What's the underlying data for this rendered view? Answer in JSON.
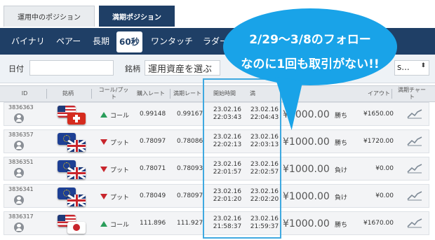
{
  "tabs": [
    {
      "label": "運用中のポジション",
      "active": false
    },
    {
      "label": "満期ポジション",
      "active": true
    }
  ],
  "nav": [
    "バイナリ",
    "ペアー",
    "長期",
    "60秒",
    "ワンタッチ",
    "ラダー"
  ],
  "nav_active": "60秒",
  "filter": {
    "date_label": "日付",
    "asset_label": "銘柄",
    "asset_value": "運用資産を選ぶ",
    "second_select_value": "s..."
  },
  "columns": {
    "id": "ID",
    "symbol": "銘柄",
    "callput_1": "コール/プッ",
    "callput_2": "ト",
    "buy_rate": "購入レート",
    "exp_rate": "満期レート",
    "start_time": "開始時間",
    "expiry": "満",
    "payout": "イアウト",
    "chart_1": "満期チャー",
    "chart_2": "ト"
  },
  "rows": [
    {
      "id": "3836363",
      "flags": [
        "us",
        "ch"
      ],
      "dir": "コール",
      "up": true,
      "buy": "0.99148",
      "exp": "0.99167",
      "start_date": "23.02.16",
      "start_time": "22:03:43",
      "end_date": "23.02.16",
      "end_time": "22:04:43",
      "amount": "¥1000.00",
      "result": "勝ち",
      "payout": "¥1650.00"
    },
    {
      "id": "3836357",
      "flags": [
        "eu",
        "gb"
      ],
      "dir": "プット",
      "up": false,
      "buy": "0.78097",
      "exp": "0.78086",
      "start_date": "23.02.16",
      "start_time": "22:02:13",
      "end_date": "23.02.16",
      "end_time": "22:03:13",
      "amount": "¥1000.00",
      "result": "勝ち",
      "payout": "¥1720.00"
    },
    {
      "id": "3836351",
      "flags": [
        "eu",
        "gb"
      ],
      "dir": "プット",
      "up": false,
      "buy": "0.78071",
      "exp": "0.78093",
      "start_date": "23.02.16",
      "start_time": "22:01:57",
      "end_date": "23.02.16",
      "end_time": "22:02:57",
      "amount": "¥1000.00",
      "result": "負け",
      "payout": "¥0.00"
    },
    {
      "id": "3836341",
      "flags": [
        "eu",
        "gb"
      ],
      "dir": "プット",
      "up": false,
      "buy": "0.78049",
      "exp": "0.78097",
      "start_date": "23.02.16",
      "start_time": "22:01:20",
      "end_date": "23.02.16",
      "end_time": "22:02:20",
      "amount": "¥1000.00",
      "result": "負け",
      "payout": "¥0.00"
    },
    {
      "id": "3836317",
      "flags": [
        "us",
        "jp"
      ],
      "dir": "コール",
      "up": true,
      "buy": "111.896",
      "exp": "111.927",
      "start_date": "23.02.16",
      "start_time": "21:58:37",
      "end_date": "23.02.16",
      "end_time": "21:59:37",
      "amount": "¥1000.00",
      "result": "勝ち",
      "payout": "¥1670.00"
    }
  ],
  "callout": {
    "line1": "2/29〜3/8のフォロー",
    "line2": "なのに1回も取引がない!!"
  },
  "colors": {
    "navy": "#1f3f66",
    "call_green": "#2a9d5a",
    "put_red": "#c8252c",
    "callout_blue": "#19a3e8",
    "highlight_border": "#3fa9e0"
  }
}
